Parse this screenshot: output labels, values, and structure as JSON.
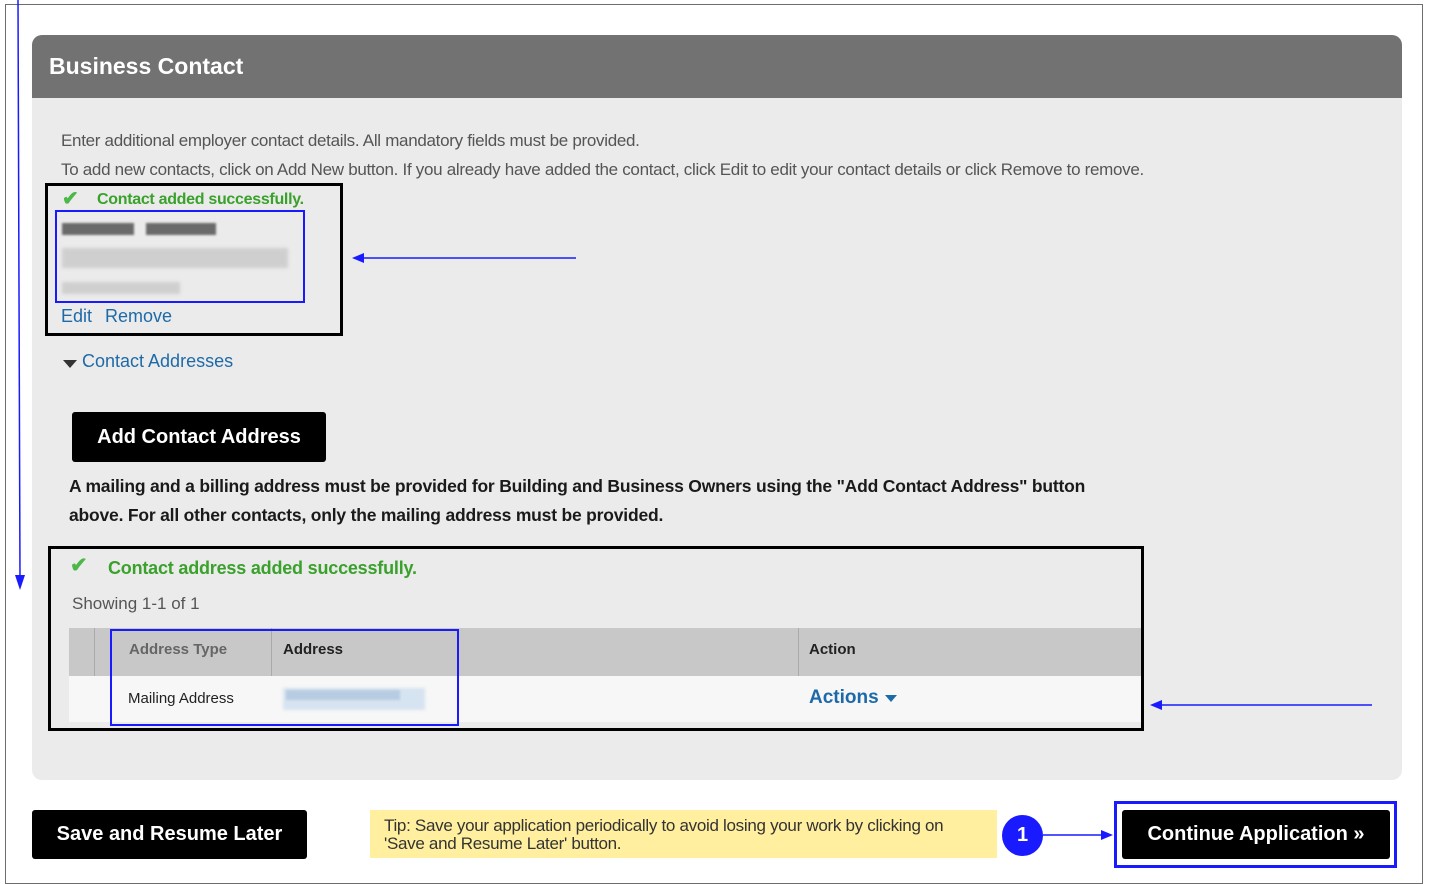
{
  "panel": {
    "title": "Business Contact",
    "intro_line1": "Enter additional employer contact details. All mandatory fields must be provided.",
    "intro_line2": "To add new contacts, click on Add New button. If you already have added the contact, click Edit to edit your contact details or click Remove to remove."
  },
  "contact": {
    "success_message": "Contact added successfully.",
    "edit_label": "Edit",
    "remove_label": "Remove"
  },
  "addresses": {
    "section_label": "Contact Addresses",
    "add_button_label": "Add Contact Address",
    "note_line1": "A mailing and a billing address must be provided for Building and Business Owners using the \"Add Contact Address\" button",
    "note_line2": "above. For all other contacts, only the mailing address must be provided.",
    "success_message": "Contact address added successfully.",
    "showing_text": "Showing 1-1 of 1",
    "table": {
      "columns": [
        "Address Type",
        "Address",
        "Action"
      ],
      "rows": [
        {
          "address_type": "Mailing Address",
          "action_label": "Actions"
        }
      ]
    }
  },
  "footer": {
    "save_label": "Save and Resume Later",
    "tip_text": "Tip: Save your application periodically to avoid losing your work by clicking on 'Save and Resume Later' button.",
    "step_badge": "1",
    "continue_label": "Continue Application »"
  },
  "colors": {
    "header_bg": "#727272",
    "panel_bg": "#ebebeb",
    "success_green": "#3aa12c",
    "link_blue": "#1e6aa8",
    "annotation_blue": "#1a1aff",
    "tip_bg": "#ffef9e"
  }
}
